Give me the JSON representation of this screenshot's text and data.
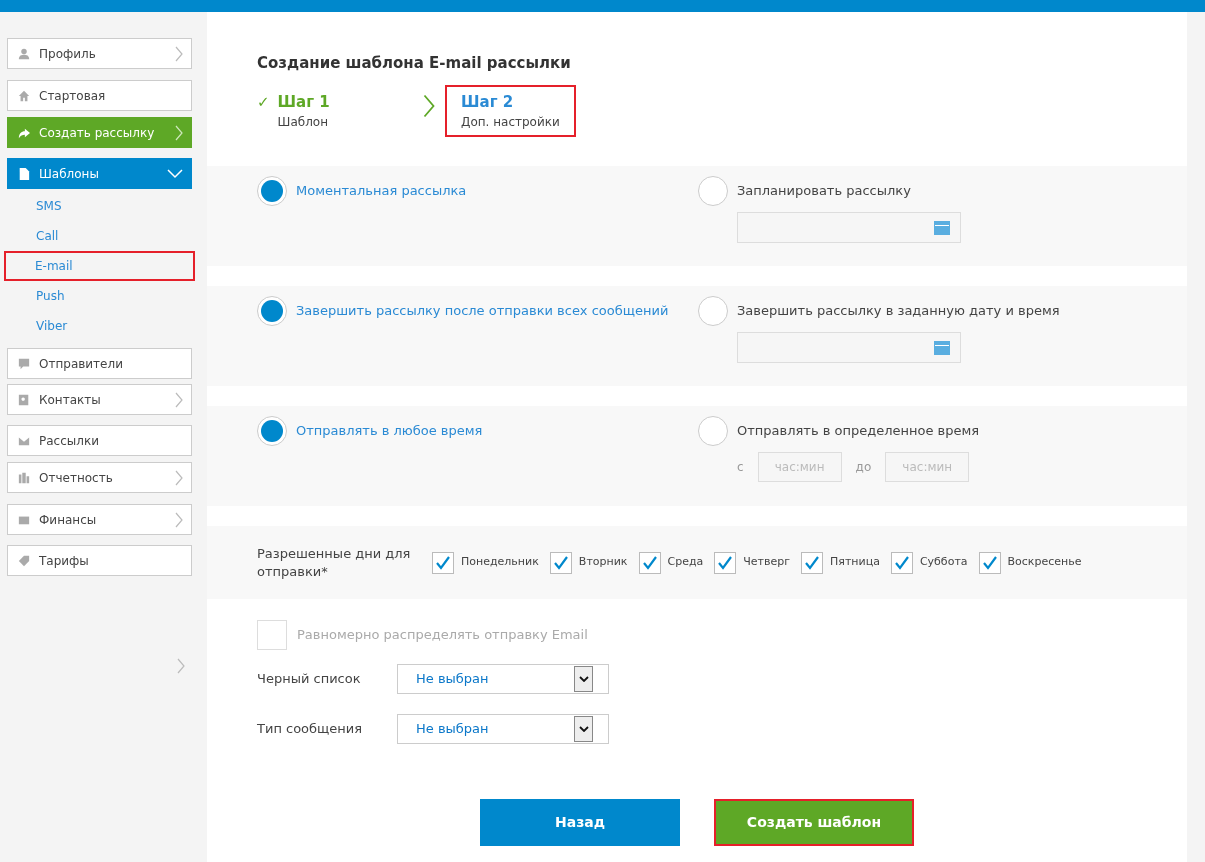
{
  "sidebar": {
    "items": [
      {
        "label": "Профиль",
        "chevron": true,
        "kind": "normal"
      },
      {
        "label": "Стартовая",
        "chevron": false,
        "kind": "normal"
      },
      {
        "label": "Создать рассылку",
        "chevron": true,
        "kind": "action"
      },
      {
        "label": "Шаблоны",
        "chevron": true,
        "kind": "active",
        "expanded": true,
        "children": [
          {
            "label": "SMS",
            "highlighted": false
          },
          {
            "label": "Call",
            "highlighted": false
          },
          {
            "label": "E-mail",
            "highlighted": true
          },
          {
            "label": "Push",
            "highlighted": false
          },
          {
            "label": "Viber",
            "highlighted": false
          }
        ]
      },
      {
        "label": "Отправители",
        "chevron": false,
        "kind": "normal"
      },
      {
        "label": "Контакты",
        "chevron": true,
        "kind": "normal"
      },
      {
        "label": "Рассылки",
        "chevron": false,
        "kind": "normal"
      },
      {
        "label": "Отчетность",
        "chevron": true,
        "kind": "normal"
      },
      {
        "label": "Финансы",
        "chevron": true,
        "kind": "normal"
      },
      {
        "label": "Тарифы",
        "chevron": false,
        "kind": "normal"
      }
    ]
  },
  "title": "Создание шаблона E-mail рассылки",
  "steps": [
    {
      "mark": "✓",
      "title": "Шаг 1",
      "subtitle": "Шаблон",
      "done": true,
      "selected": false,
      "highlighted": false
    },
    {
      "title": "Шаг 2",
      "subtitle": "Доп. настройки",
      "done": false,
      "selected": true,
      "highlighted": true
    }
  ],
  "sections": [
    {
      "options": [
        {
          "label": "Моментальная рассылка",
          "selected": true
        },
        {
          "label": "Запланировать рассылку",
          "selected": false,
          "extra": {
            "kind": "date"
          }
        }
      ]
    },
    {
      "options": [
        {
          "label": "Завершить рассылку после отправки всех сообщений",
          "selected": true
        },
        {
          "label": "Завершить рассылку в заданную дату и время",
          "selected": false,
          "extra": {
            "kind": "date"
          }
        }
      ]
    },
    {
      "options": [
        {
          "label": "Отправлять в любое время",
          "selected": true
        },
        {
          "label": "Отправлять в определенное время",
          "selected": false,
          "extra": {
            "kind": "time",
            "from_label": "с",
            "from_placeholder": "час:мин",
            "to_label": "до",
            "to_placeholder": "час:мин"
          }
        }
      ]
    }
  ],
  "days": {
    "label": "Разрешенные дни для отправки*",
    "items": [
      {
        "label": "Понедельник",
        "checked": true
      },
      {
        "label": "Вторник",
        "checked": true
      },
      {
        "label": "Среда",
        "checked": true
      },
      {
        "label": "Четверг",
        "checked": true
      },
      {
        "label": "Пятница",
        "checked": true
      },
      {
        "label": "Суббота",
        "checked": true
      },
      {
        "label": "Воскресенье",
        "checked": true
      }
    ]
  },
  "distribute": {
    "label": "Равномерно распределять отправку Email",
    "checked": false
  },
  "selects": [
    {
      "label": "Черный список",
      "value": "Не выбран"
    },
    {
      "label": "Тип сообщения",
      "value": "Не выбран"
    }
  ],
  "buttons": [
    {
      "label": "Назад",
      "kind": "back",
      "highlighted": false
    },
    {
      "label": "Создать шаблон",
      "kind": "primary",
      "highlighted": true
    }
  ]
}
